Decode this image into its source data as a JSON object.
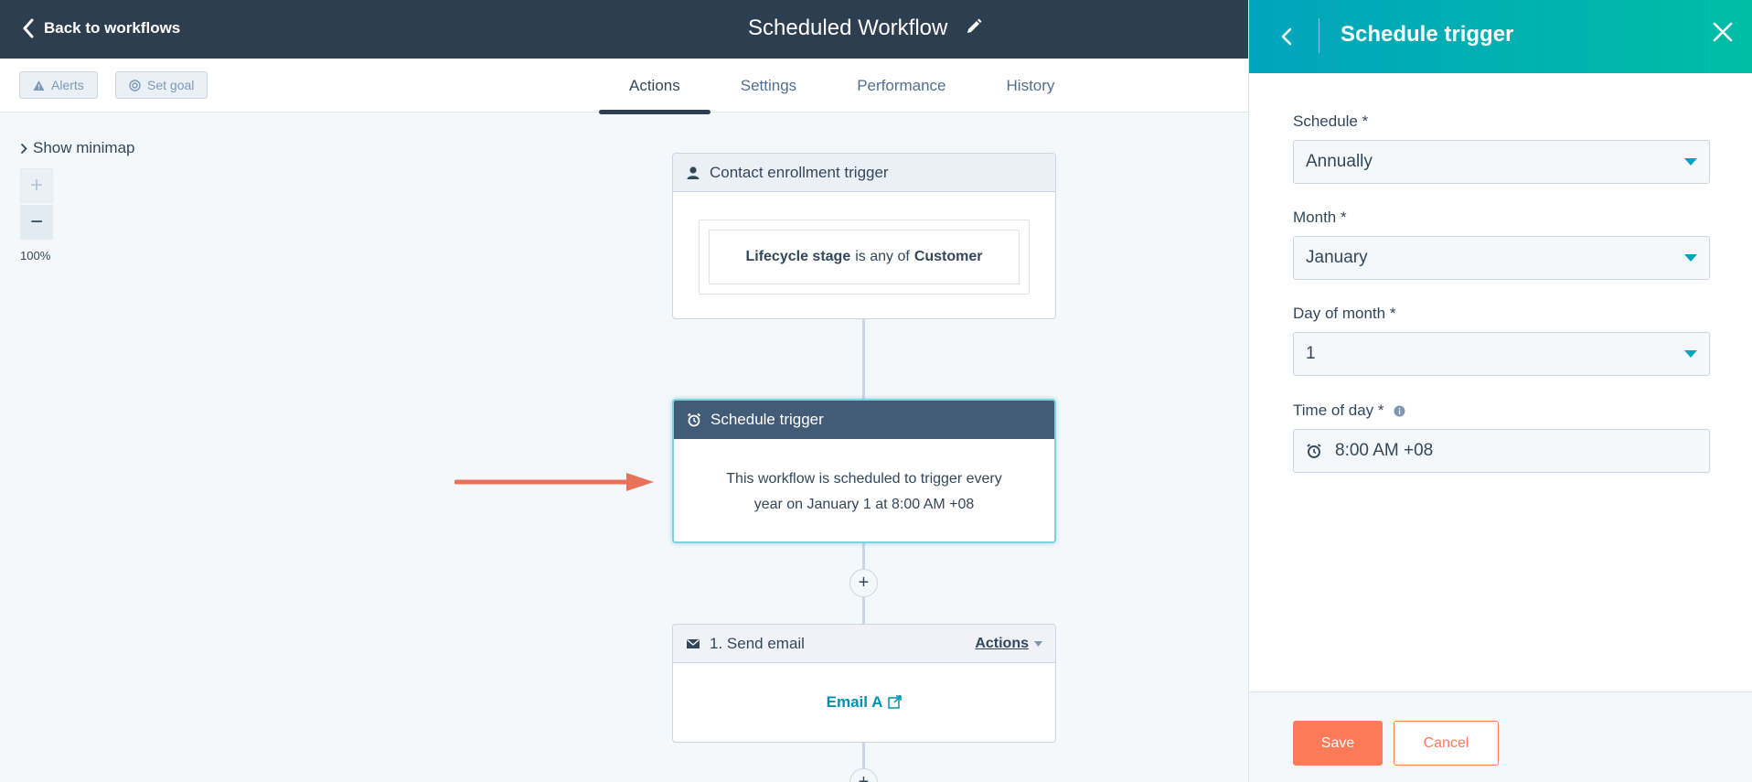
{
  "header": {
    "back_label": "Back to workflows",
    "title": "Scheduled Workflow"
  },
  "toolbar": {
    "alerts_label": "Alerts",
    "set_goal_label": "Set goal",
    "tabs": [
      {
        "label": "Actions",
        "active": true
      },
      {
        "label": "Settings",
        "active": false
      },
      {
        "label": "Performance",
        "active": false
      },
      {
        "label": "History",
        "active": false
      }
    ]
  },
  "canvas": {
    "minimap_label": "Show minimap",
    "zoom_in": "+",
    "zoom_out": "−",
    "zoom_level": "100%",
    "enrollment": {
      "title": "Contact enrollment trigger",
      "filter_property": "Lifecycle stage",
      "filter_operator": "is any of",
      "filter_value": "Customer"
    },
    "schedule": {
      "title": "Schedule trigger",
      "description": "This workflow is scheduled to trigger every year on January 1 at 8:00 AM +08"
    },
    "plus_label": "+",
    "email_action": {
      "title": "1. Send email",
      "actions_label": "Actions",
      "email_name": "Email A"
    }
  },
  "panel": {
    "title": "Schedule trigger",
    "fields": {
      "schedule": {
        "label": "Schedule *",
        "value": "Annually"
      },
      "month": {
        "label": "Month *",
        "value": "January"
      },
      "day": {
        "label": "Day of month *",
        "value": "1"
      },
      "time": {
        "label": "Time of day *",
        "value": "8:00 AM +08"
      }
    },
    "save_label": "Save",
    "cancel_label": "Cancel"
  },
  "colors": {
    "header_bg": "#2d3e50",
    "panel_gradient_start": "#00a4bd",
    "panel_gradient_end": "#00bda5",
    "accent_orange": "#ff7a59",
    "link_teal": "#0091ae",
    "schedule_card_head": "#425b76"
  }
}
